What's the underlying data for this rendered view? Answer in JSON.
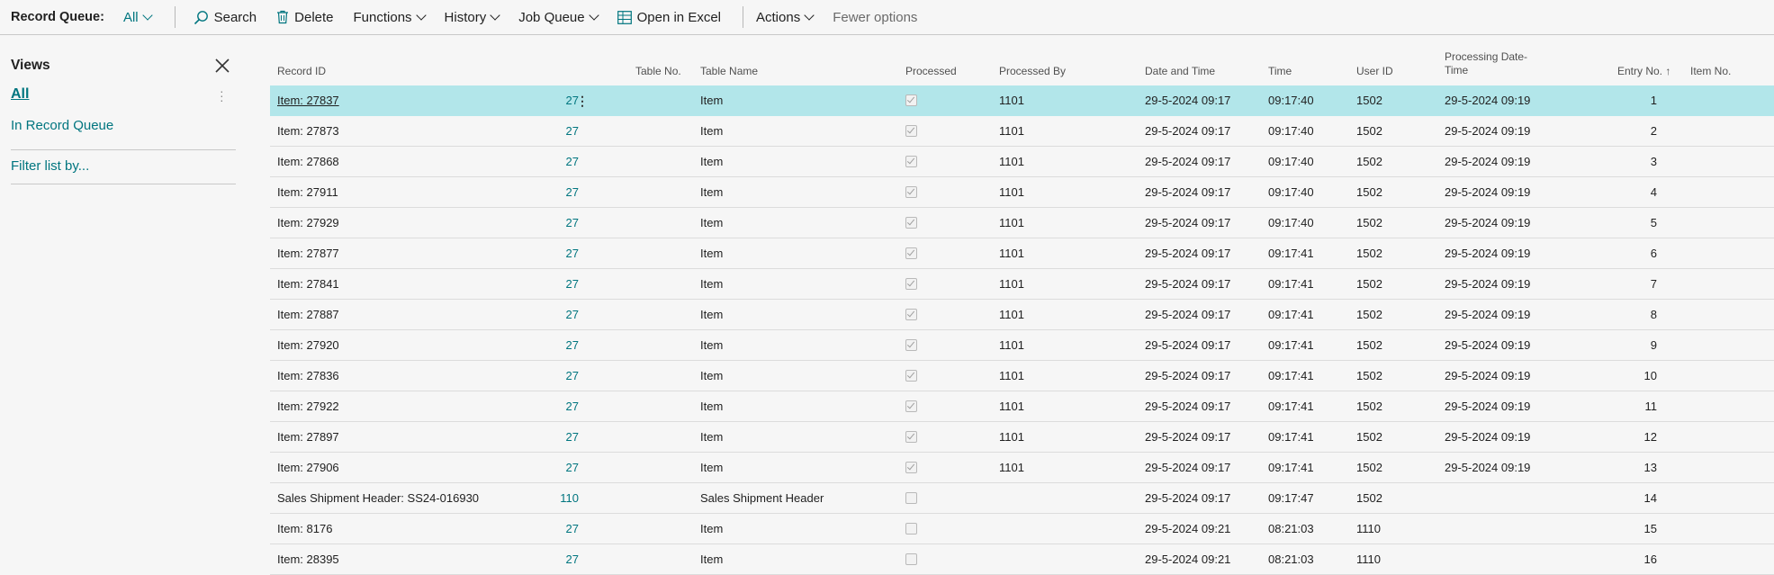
{
  "actionbar": {
    "title": "Record Queue:",
    "view": "All",
    "search": "Search",
    "delete": "Delete",
    "functions": "Functions",
    "history": "History",
    "job_queue": "Job Queue",
    "open_excel": "Open in Excel",
    "actions": "Actions",
    "fewer": "Fewer options"
  },
  "views": {
    "title": "Views",
    "all": "All",
    "record_queue": "In Record Queue",
    "filter": "Filter list by..."
  },
  "columns": {
    "record_id": "Record ID",
    "table_no": "Table No.",
    "table_name": "Table Name",
    "processed": "Processed",
    "processed_by": "Processed By",
    "date_time": "Date and Time",
    "time": "Time",
    "user_id": "User ID",
    "processing_dt_1": "Processing Date-",
    "processing_dt_2": "Time",
    "entry_no": "Entry No.",
    "entry_sort": "↑",
    "item_no": "Item No."
  },
  "rows": [
    {
      "record_id": "Item: 27837",
      "table_no": "27",
      "table_name": "Item",
      "processed": true,
      "processed_by": "1101",
      "date_time": "29-5-2024 09:17",
      "time": "09:17:40",
      "user_id": "1502",
      "processing_dt": "29-5-2024 09:19",
      "entry_no": "1",
      "selected": true
    },
    {
      "record_id": "Item: 27873",
      "table_no": "27",
      "table_name": "Item",
      "processed": true,
      "processed_by": "1101",
      "date_time": "29-5-2024 09:17",
      "time": "09:17:40",
      "user_id": "1502",
      "processing_dt": "29-5-2024 09:19",
      "entry_no": "2"
    },
    {
      "record_id": "Item: 27868",
      "table_no": "27",
      "table_name": "Item",
      "processed": true,
      "processed_by": "1101",
      "date_time": "29-5-2024 09:17",
      "time": "09:17:40",
      "user_id": "1502",
      "processing_dt": "29-5-2024 09:19",
      "entry_no": "3"
    },
    {
      "record_id": "Item: 27911",
      "table_no": "27",
      "table_name": "Item",
      "processed": true,
      "processed_by": "1101",
      "date_time": "29-5-2024 09:17",
      "time": "09:17:40",
      "user_id": "1502",
      "processing_dt": "29-5-2024 09:19",
      "entry_no": "4"
    },
    {
      "record_id": "Item: 27929",
      "table_no": "27",
      "table_name": "Item",
      "processed": true,
      "processed_by": "1101",
      "date_time": "29-5-2024 09:17",
      "time": "09:17:40",
      "user_id": "1502",
      "processing_dt": "29-5-2024 09:19",
      "entry_no": "5"
    },
    {
      "record_id": "Item: 27877",
      "table_no": "27",
      "table_name": "Item",
      "processed": true,
      "processed_by": "1101",
      "date_time": "29-5-2024 09:17",
      "time": "09:17:41",
      "user_id": "1502",
      "processing_dt": "29-5-2024 09:19",
      "entry_no": "6"
    },
    {
      "record_id": "Item: 27841",
      "table_no": "27",
      "table_name": "Item",
      "processed": true,
      "processed_by": "1101",
      "date_time": "29-5-2024 09:17",
      "time": "09:17:41",
      "user_id": "1502",
      "processing_dt": "29-5-2024 09:19",
      "entry_no": "7"
    },
    {
      "record_id": "Item: 27887",
      "table_no": "27",
      "table_name": "Item",
      "processed": true,
      "processed_by": "1101",
      "date_time": "29-5-2024 09:17",
      "time": "09:17:41",
      "user_id": "1502",
      "processing_dt": "29-5-2024 09:19",
      "entry_no": "8"
    },
    {
      "record_id": "Item: 27920",
      "table_no": "27",
      "table_name": "Item",
      "processed": true,
      "processed_by": "1101",
      "date_time": "29-5-2024 09:17",
      "time": "09:17:41",
      "user_id": "1502",
      "processing_dt": "29-5-2024 09:19",
      "entry_no": "9"
    },
    {
      "record_id": "Item: 27836",
      "table_no": "27",
      "table_name": "Item",
      "processed": true,
      "processed_by": "1101",
      "date_time": "29-5-2024 09:17",
      "time": "09:17:41",
      "user_id": "1502",
      "processing_dt": "29-5-2024 09:19",
      "entry_no": "10"
    },
    {
      "record_id": "Item: 27922",
      "table_no": "27",
      "table_name": "Item",
      "processed": true,
      "processed_by": "1101",
      "date_time": "29-5-2024 09:17",
      "time": "09:17:41",
      "user_id": "1502",
      "processing_dt": "29-5-2024 09:19",
      "entry_no": "11"
    },
    {
      "record_id": "Item: 27897",
      "table_no": "27",
      "table_name": "Item",
      "processed": true,
      "processed_by": "1101",
      "date_time": "29-5-2024 09:17",
      "time": "09:17:41",
      "user_id": "1502",
      "processing_dt": "29-5-2024 09:19",
      "entry_no": "12"
    },
    {
      "record_id": "Item: 27906",
      "table_no": "27",
      "table_name": "Item",
      "processed": true,
      "processed_by": "1101",
      "date_time": "29-5-2024 09:17",
      "time": "09:17:41",
      "user_id": "1502",
      "processing_dt": "29-5-2024 09:19",
      "entry_no": "13"
    },
    {
      "record_id": "Sales Shipment Header: SS24-016930",
      "table_no": "110",
      "table_name": "Sales Shipment Header",
      "processed": false,
      "processed_by": "",
      "date_time": "29-5-2024 09:17",
      "time": "09:17:47",
      "user_id": "1502",
      "processing_dt": "",
      "entry_no": "14"
    },
    {
      "record_id": "Item: 8176",
      "table_no": "27",
      "table_name": "Item",
      "processed": false,
      "processed_by": "",
      "date_time": "29-5-2024 09:21",
      "time": "08:21:03",
      "user_id": "1110",
      "processing_dt": "",
      "entry_no": "15"
    },
    {
      "record_id": "Item: 28395",
      "table_no": "27",
      "table_name": "Item",
      "processed": false,
      "processed_by": "",
      "date_time": "29-5-2024 09:21",
      "time": "08:21:03",
      "user_id": "1110",
      "processing_dt": "",
      "entry_no": "16"
    }
  ]
}
